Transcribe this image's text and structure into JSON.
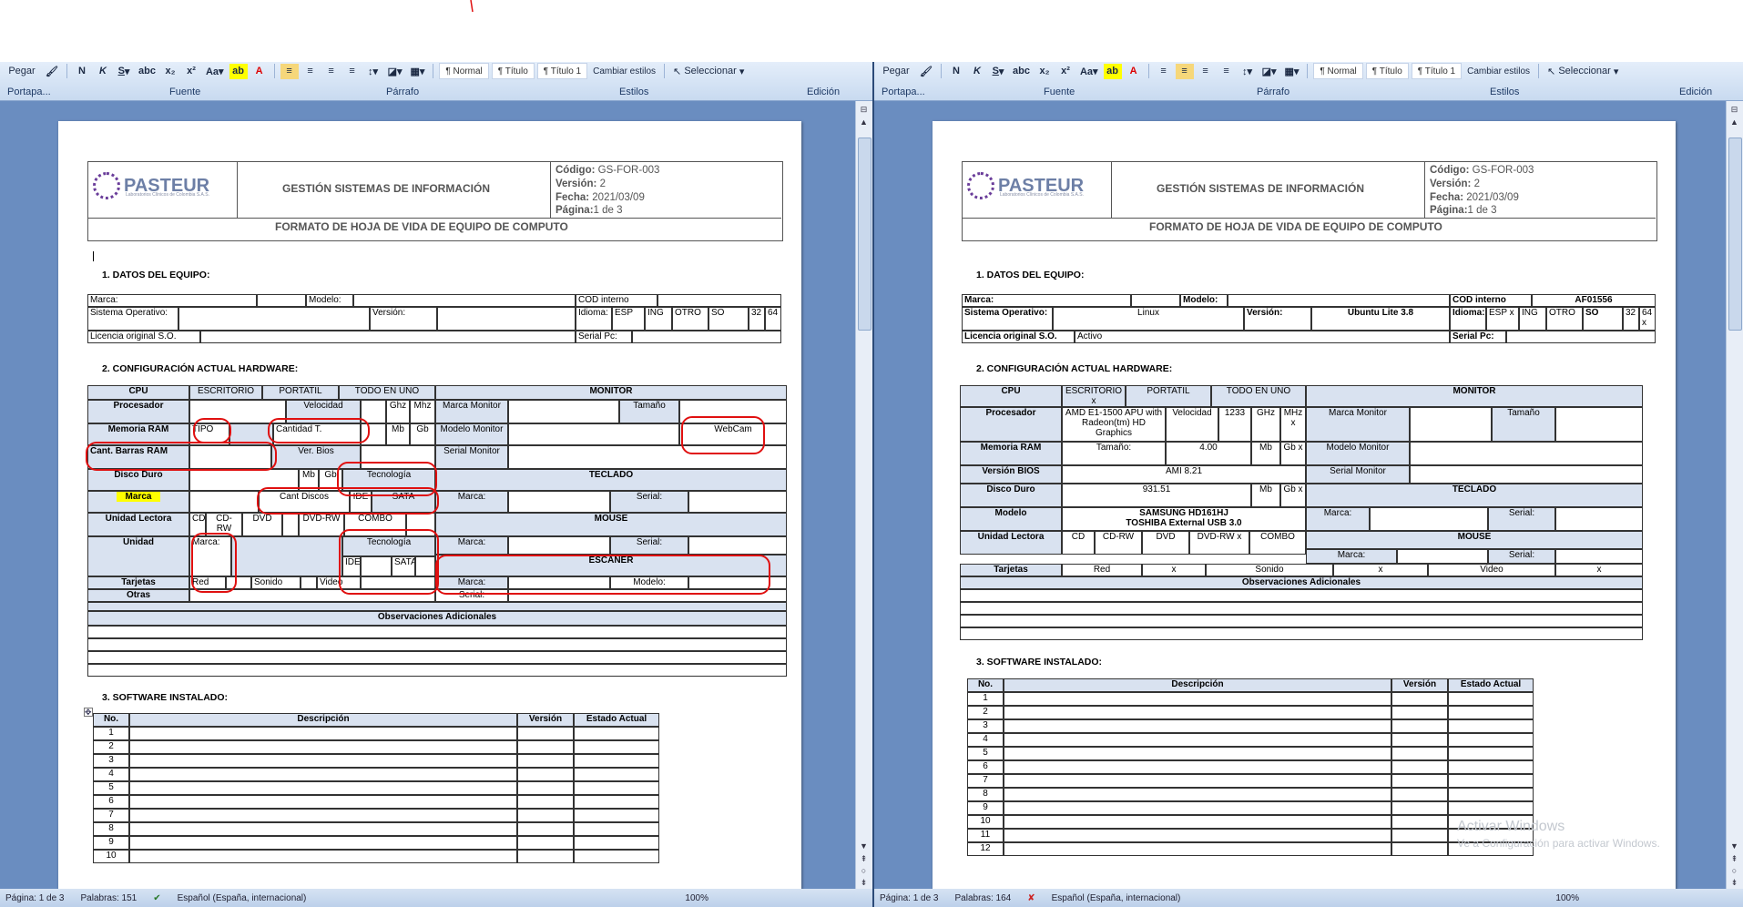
{
  "ribbon": {
    "paste_label": "Pegar",
    "group_clipboard": "Portapa...",
    "group_font": "Fuente",
    "group_paragraph": "Párrafo",
    "group_styles": "Estilos",
    "group_editing": "Edición",
    "style_normal": "¶ Normal",
    "style_titulo": "¶ Título",
    "style_titulo1": "¶ Título 1",
    "change_styles": "Cambiar estilos",
    "select_label": "Seleccionar"
  },
  "header": {
    "logo": "PASTEUR",
    "logo_sub": "Laboratorios Clínicos de Colombia S.A.S.",
    "title": "GESTIÓN SISTEMAS DE INFORMACIÓN",
    "code_label": "Código:",
    "code": "GS-FOR-003",
    "version_label": "Versión:",
    "version": "2",
    "date_label": "Fecha:",
    "date": "2021/03/09",
    "page_label": "Página:",
    "page": "1 de 3",
    "form_title": "FORMATO DE HOJA DE VIDA DE EQUIPO DE COMPUTO"
  },
  "sections": {
    "s1": "1.    DATOS DEL EQUIPO:",
    "s2": "2.    CONFIGURACIÓN ACTUAL HARDWARE:",
    "s3": "3.    SOFTWARE INSTALADO:"
  },
  "left": {
    "marca": "Marca:",
    "modelo": "Modelo:",
    "cod_interno": "COD interno",
    "so": "Sistema Operativo:",
    "version": "Versión:",
    "idioma": "Idioma:",
    "esp": "ESP",
    "ing": "ING",
    "otro": "OTRO",
    "so_short": "SO",
    "b32": "32",
    "b64": "64",
    "licencia": "Licencia original S.O.",
    "serial_pc": "Serial Pc:",
    "cpu": "CPU",
    "escritorio": "ESCRITORIO",
    "portatil": "PORTATIL",
    "todo": "TODO EN UNO",
    "monitor": "MONITOR",
    "procesador": "Procesador",
    "velocidad": "Velocidad",
    "ghz": "Ghz",
    "mhz": "Mhz",
    "marca_monitor": "Marca Monitor",
    "tamano": "Tamaño",
    "memoria": "Memoria RAM",
    "tipo": "TIPO",
    "cantidad": "Cantidad T.",
    "mb": "Mb",
    "gb": "Gb",
    "modelo_monitor": "Modelo Monitor",
    "webcam": "WebCam",
    "barras": "Cant. Barras RAM",
    "ver_bios": "Ver. Bios",
    "serial_monitor": "Serial Monitor",
    "disco": "Disco Duro",
    "mb2": "Mb",
    "gb2": "Gb",
    "tecnologia": "Tecnología",
    "teclado": "TECLADO",
    "marca_hl": "Marca",
    "cant_discos": "Cant Discos",
    "ide": "IDE",
    "sata": "SATA",
    "marca_t": "Marca:",
    "serial_t": "Serial:",
    "lectora": "Unidad Lectora",
    "cd": "CD",
    "cdrw": "CD-RW",
    "dvd": "DVD",
    "dvdrw": "DVD-RW",
    "combo": "COMBO",
    "mouse": "MOUSE",
    "unidad": "Unidad",
    "marca_u": "Marca:",
    "tecnologia2": "Tecnología",
    "marca_m": "Marca:",
    "serial_m": "Serial:",
    "ide2": "IDE",
    "sata2": "SATA",
    "escaner": "ESCANER",
    "tarjetas": "Tarjetas",
    "red": "Red",
    "sonido": "Sonido",
    "video": "Video",
    "marca_e": "Marca:",
    "modelo_e": "Modelo:",
    "otras": "Otras",
    "serial_e": "Serial:",
    "obs": "Observaciones Adicionales",
    "no": "No.",
    "descripcion": "Descripción",
    "version_sw": "Versión",
    "estado": "Estado Actual",
    "rows": [
      "1",
      "2",
      "3",
      "4",
      "5",
      "6",
      "7",
      "8",
      "9",
      "10"
    ]
  },
  "right": {
    "marca": "Marca:",
    "modelo": "Modelo:",
    "cod_interno": "COD interno",
    "cod_value": "AF01556",
    "so": "Sistema Operativo:",
    "so_value": "Linux",
    "version": "Versión:",
    "version_value": "Ubuntu Lite 3.8",
    "idioma": "Idioma:",
    "esp": "ESP x",
    "ing": "ING",
    "otro": "OTRO",
    "so_short": "SO",
    "b32": "32",
    "b64": "64 x",
    "licencia": "Licencia original S.O.",
    "licencia_value": "Activo",
    "serial_pc": "Serial Pc:",
    "cpu": "CPU",
    "escritorio": "ESCRITORIO x",
    "portatil": "PORTATIL",
    "todo": "TODO EN UNO",
    "monitor": "MONITOR",
    "procesador": "Procesador",
    "proc_value": "AMD E1-1500 APU with Radeon(tm) HD Graphics",
    "velocidad": "Velocidad",
    "vel_value": "1233",
    "ghz": "GHz",
    "mhz": "MHz x",
    "marca_monitor": "Marca Monitor",
    "tamano": "Tamaño",
    "memoria": "Memoria RAM",
    "tamano_ram": "Tamaño:",
    "ram_value": "4.00",
    "mb": "Mb",
    "gb": "Gb x",
    "modelo_monitor": "Modelo Monitor",
    "bios": "Versión  BIOS",
    "bios_value": "AMI 8.21",
    "serial_monitor": "Serial Monitor",
    "disco": "Disco Duro",
    "disco_value": "931.51",
    "mb2": "Mb",
    "gb2": "Gb x",
    "teclado": "TECLADO",
    "modelo_d": "Modelo",
    "modelo_d_value1": "SAMSUNG HD161HJ",
    "modelo_d_value2": "TOSHIBA External USB 3.0",
    "marca_t": "Marca:",
    "serial_t": "Serial:",
    "lectora": "Unidad Lectora",
    "cd": "CD",
    "cdrw": "CD-RW",
    "dvd": "DVD",
    "dvdrw": "DVD-RW x",
    "combo": "COMBO",
    "mouse": "MOUSE",
    "marca_m": "Marca:",
    "serial_m": "Serial:",
    "tarjetas": "Tarjetas",
    "red": "Red",
    "x1": "x",
    "sonido": "Sonido",
    "x2": "x",
    "video": "Video",
    "x3": "x",
    "obs": "Observaciones Adicionales",
    "no": "No.",
    "descripcion": "Descripción",
    "version_sw": "Versión",
    "estado": "Estado Actual",
    "rows": [
      "1",
      "2",
      "3",
      "4",
      "5",
      "6",
      "7",
      "8",
      "9",
      "10",
      "11",
      "12"
    ]
  },
  "status_left": {
    "page": "Página: 1 de 3",
    "words": "Palabras: 151",
    "lang": "Español (España, internacional)",
    "zoom": "100%"
  },
  "status_right": {
    "page": "Página: 1 de 3",
    "words": "Palabras: 164",
    "lang": "Español (España, internacional)",
    "zoom": "100%"
  },
  "watermark": {
    "line1": "Activar Windows",
    "line2": "Ve a Configuración para activar Windows."
  }
}
